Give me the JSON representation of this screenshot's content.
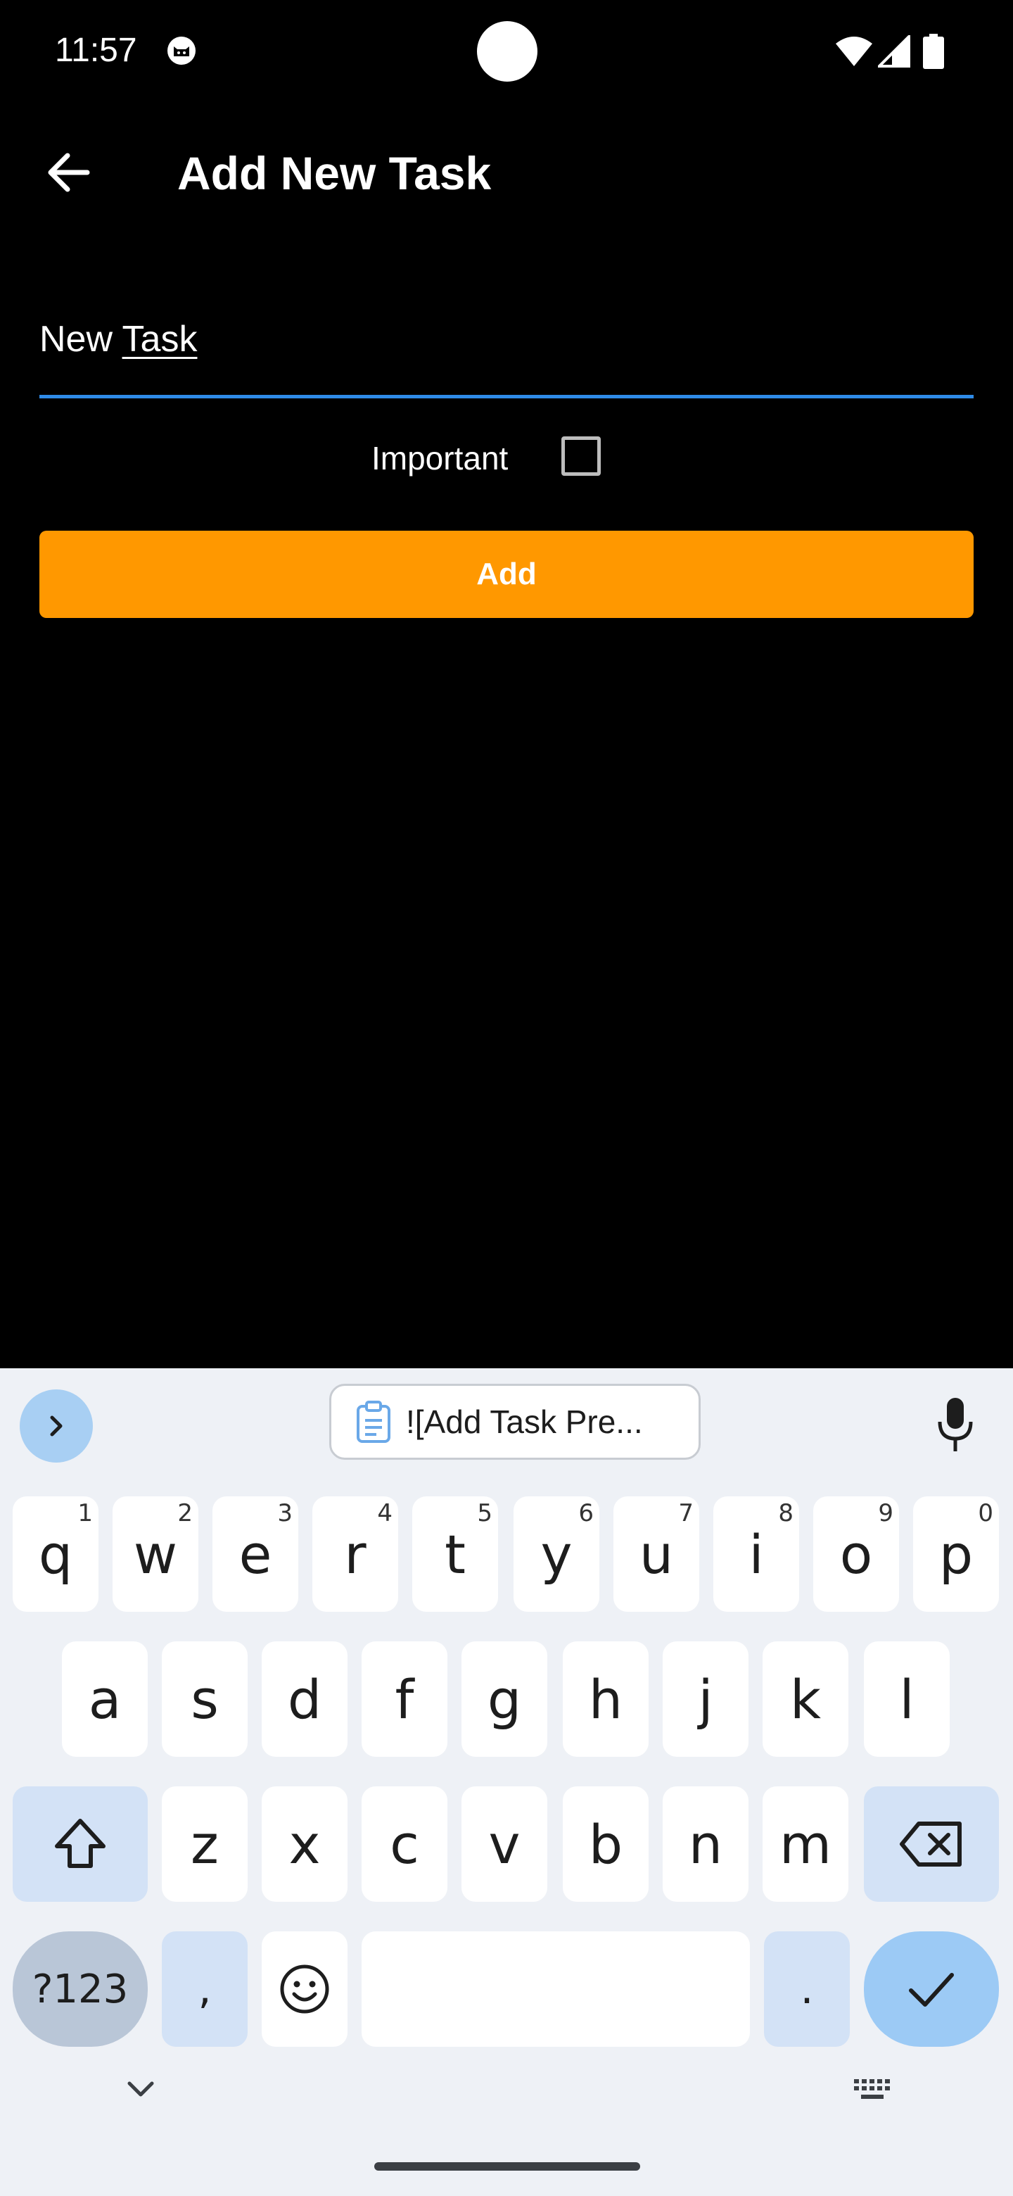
{
  "status_bar": {
    "time": "11:57"
  },
  "app_bar": {
    "back_icon": "arrow-back",
    "title": "Add New Task"
  },
  "form": {
    "task_value_word1": "New ",
    "task_value_word2": "Task",
    "important_label": "Important",
    "important_checked": false,
    "add_button_label": "Add"
  },
  "colors": {
    "accent_button": "#ff9800",
    "input_underline": "#2f8be8",
    "background": "#000000",
    "keyboard_bg": "#eef1f6"
  },
  "keyboard": {
    "clipboard_suggestion": "![Add Task Pre...",
    "row1": [
      {
        "key": "q",
        "hint": "1"
      },
      {
        "key": "w",
        "hint": "2"
      },
      {
        "key": "e",
        "hint": "3"
      },
      {
        "key": "r",
        "hint": "4"
      },
      {
        "key": "t",
        "hint": "5"
      },
      {
        "key": "y",
        "hint": "6"
      },
      {
        "key": "u",
        "hint": "7"
      },
      {
        "key": "i",
        "hint": "8"
      },
      {
        "key": "o",
        "hint": "9"
      },
      {
        "key": "p",
        "hint": "0"
      }
    ],
    "row2": [
      "a",
      "s",
      "d",
      "f",
      "g",
      "h",
      "j",
      "k",
      "l"
    ],
    "row3": [
      "z",
      "x",
      "c",
      "v",
      "b",
      "n",
      "m"
    ],
    "symbols_label": "?123",
    "comma_label": ",",
    "period_label": "."
  }
}
